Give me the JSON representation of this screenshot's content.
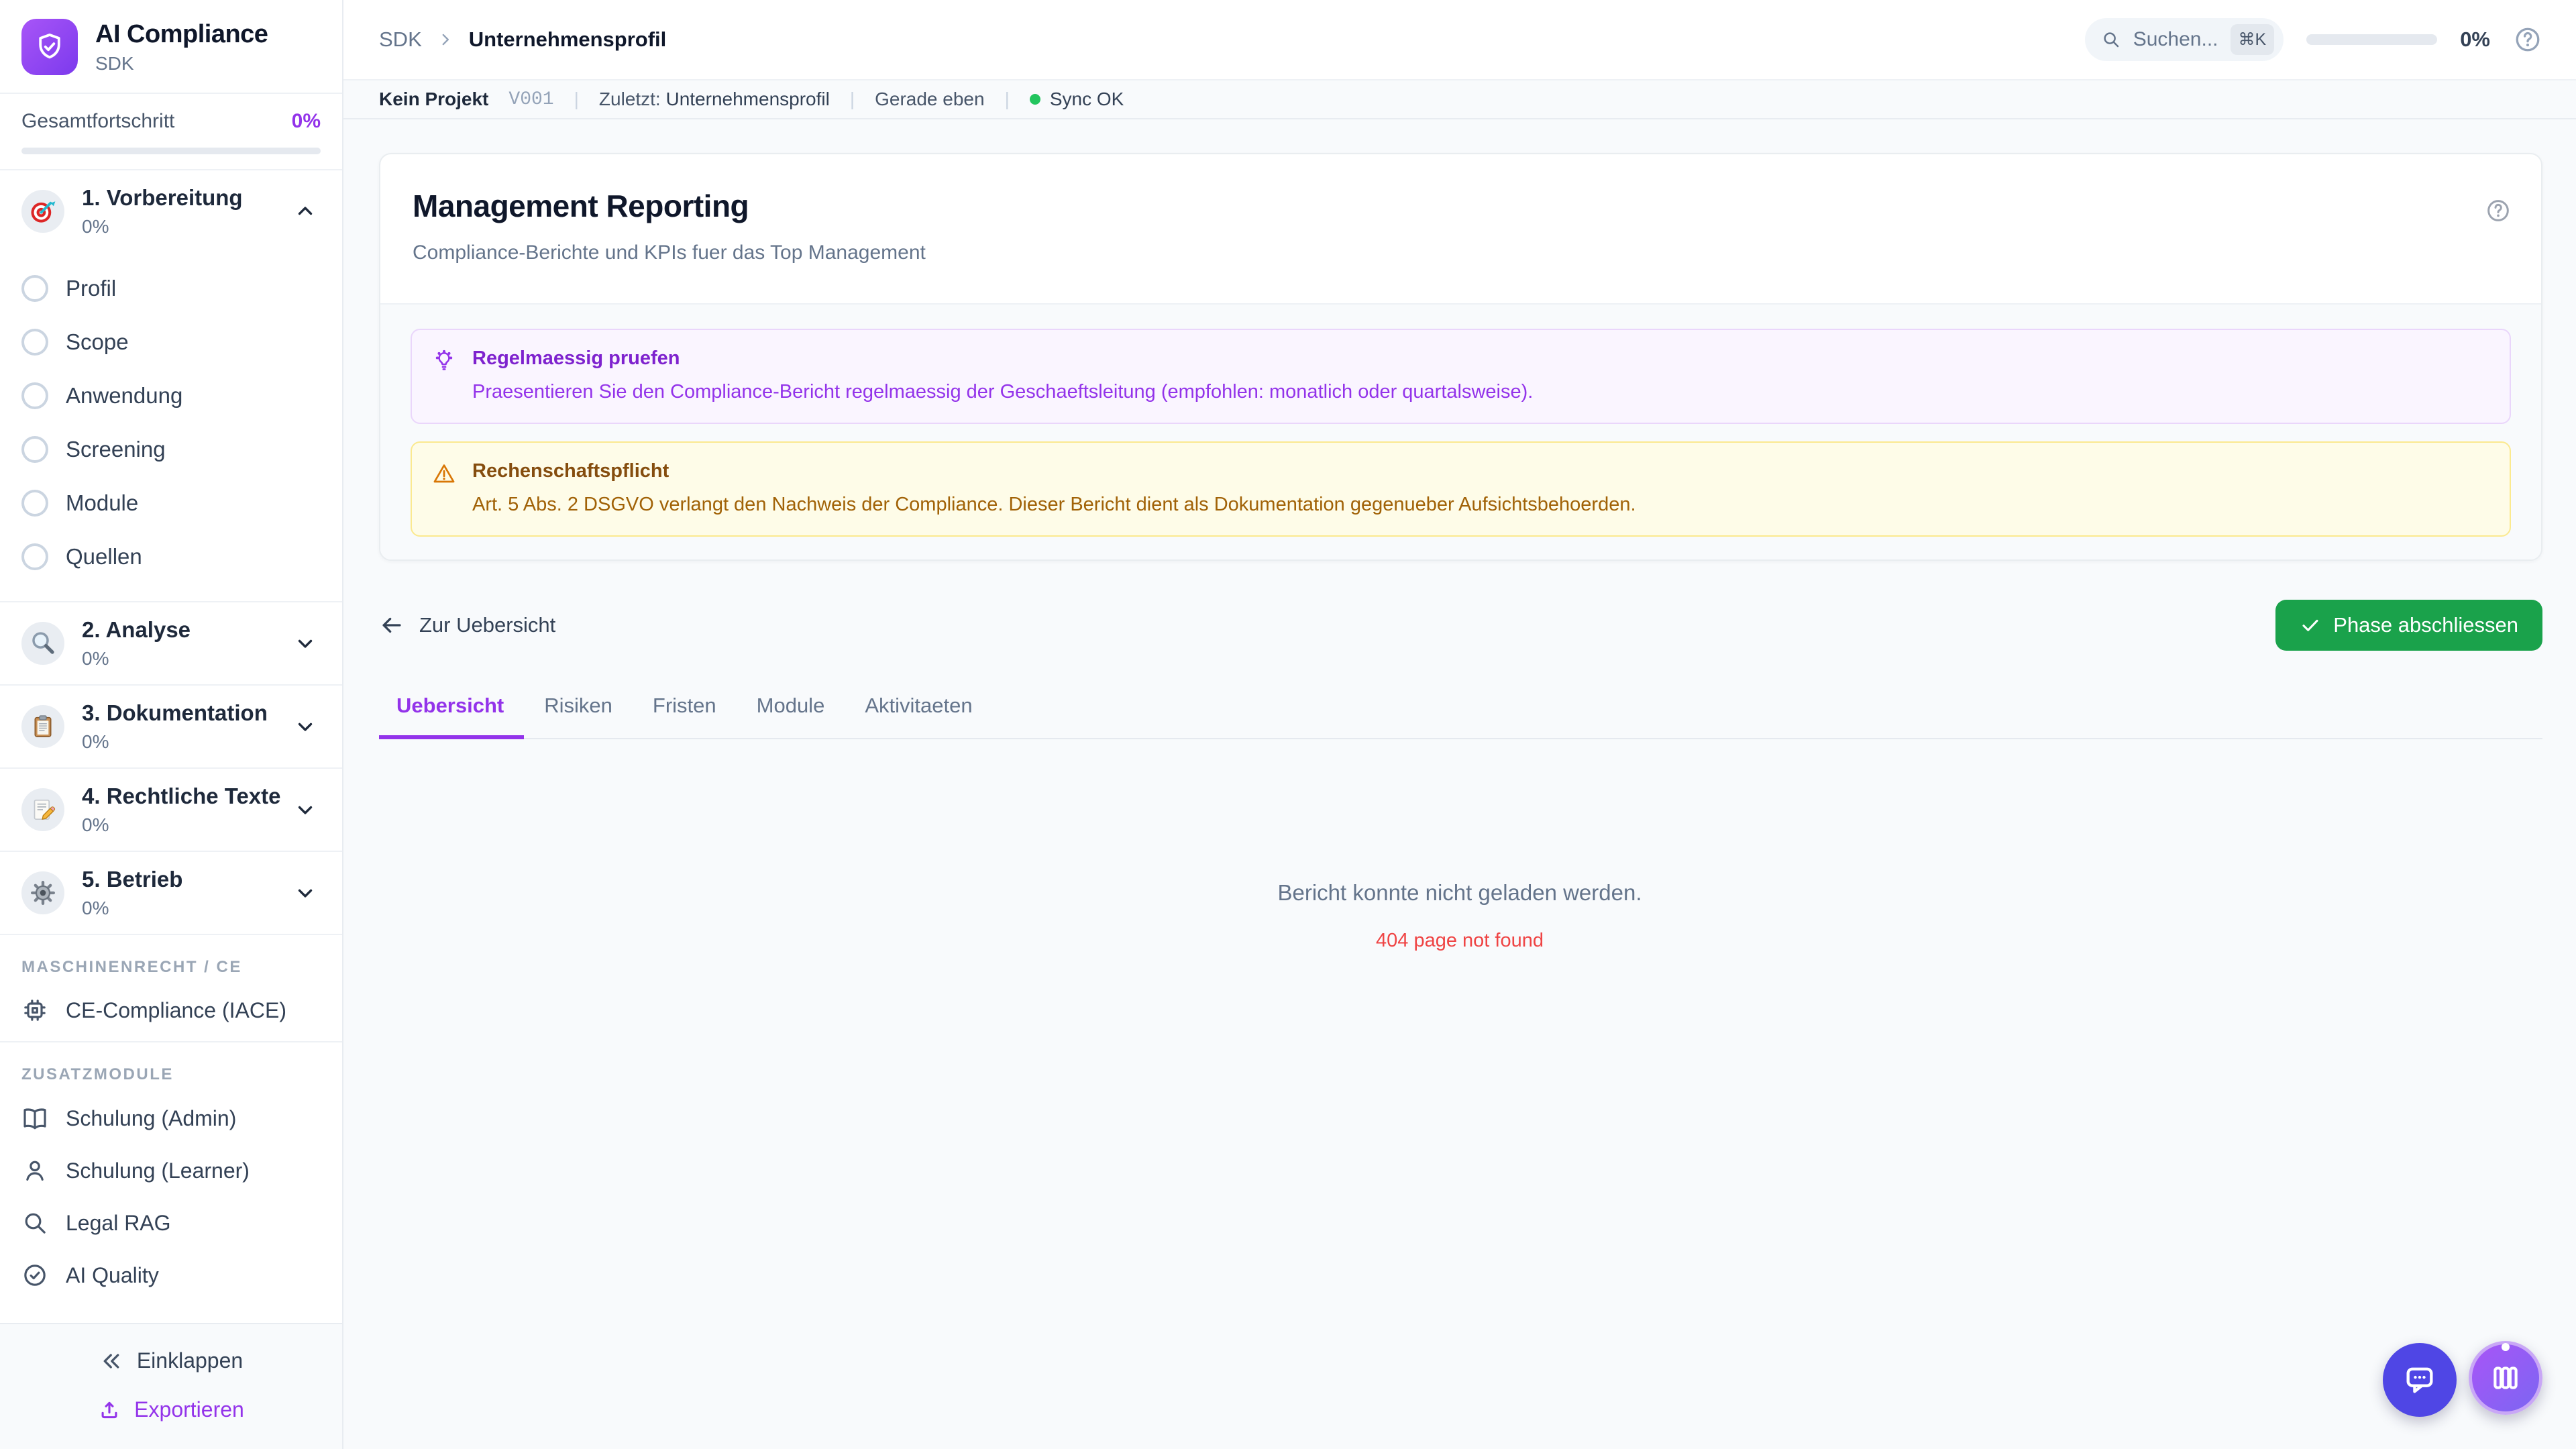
{
  "colors": {
    "accent": "#9333ea",
    "success": "#1aa24b",
    "error": "#ef4444",
    "sync": "#22c55e",
    "logo_gradient": [
      "#a855f7",
      "#7c3aed"
    ]
  },
  "sidebar": {
    "app_title": "AI Compliance",
    "app_subtitle": "SDK",
    "overall_progress_label": "Gesamtfortschritt",
    "overall_progress_value": "0%",
    "overall_progress_percent": 0,
    "phases": [
      {
        "label": "1. Vorbereitung",
        "progress": "0%",
        "icon": "target-icon",
        "expanded": true,
        "steps": [
          "Profil",
          "Scope",
          "Anwendung",
          "Screening",
          "Module",
          "Quellen"
        ]
      },
      {
        "label": "2. Analyse",
        "progress": "0%",
        "icon": "magnifier-icon",
        "expanded": false
      },
      {
        "label": "3. Dokumentation",
        "progress": "0%",
        "icon": "clipboard-icon",
        "expanded": false
      },
      {
        "label": "4. Rechtliche Texte",
        "progress": "0%",
        "icon": "memo-pencil-icon",
        "expanded": false
      },
      {
        "label": "5. Betrieb",
        "progress": "0%",
        "icon": "gear-icon",
        "expanded": false
      }
    ],
    "section_maschinenrecht": {
      "label": "MASCHINENRECHT / CE",
      "items": [
        {
          "label": "CE-Compliance (IACE)",
          "icon": "chip-icon"
        }
      ]
    },
    "section_zusatzmodule": {
      "label": "ZUSATZMODULE",
      "items": [
        {
          "label": "Schulung (Admin)",
          "icon": "book-open-icon"
        },
        {
          "label": "Schulung (Learner)",
          "icon": "person-icon"
        },
        {
          "label": "Legal RAG",
          "icon": "search-icon"
        },
        {
          "label": "AI Quality",
          "icon": "check-circle-icon"
        }
      ]
    },
    "footer": {
      "collapse_label": "Einklappen",
      "export_label": "Exportieren"
    }
  },
  "topbar": {
    "breadcrumb": {
      "root": "SDK",
      "current": "Unternehmensprofil"
    },
    "search_placeholder": "Suchen...",
    "search_shortcut": "⌘K",
    "progress_value": "0%",
    "progress_percent": 0
  },
  "statusbar": {
    "project": "Kein Projekt",
    "version": "V001",
    "sep": "|",
    "last_label": "Zuletzt:",
    "last_value": "Unternehmensprofil",
    "time": "Gerade eben",
    "sync": "Sync OK"
  },
  "page": {
    "title": "Management Reporting",
    "subtitle": "Compliance-Berichte und KPIs fuer das Top Management",
    "notices": [
      {
        "type": "tip",
        "icon": "lightbulb-icon",
        "title": "Regelmaessig pruefen",
        "text": "Praesentieren Sie den Compliance-Bericht regelmaessig der Geschaeftsleitung (empfohlen: monatlich oder quartalsweise)."
      },
      {
        "type": "warning",
        "icon": "warning-triangle-icon",
        "title": "Rechenschaftspflicht",
        "text": "Art. 5 Abs. 2 DSGVO verlangt den Nachweis der Compliance. Dieser Bericht dient als Dokumentation gegenueber Aufsichtsbehoerden."
      }
    ],
    "back_label": "Zur Uebersicht",
    "complete_label": "Phase abschliessen",
    "tabs": [
      "Uebersicht",
      "Risiken",
      "Fristen",
      "Module",
      "Aktivitaeten"
    ],
    "active_tab": "Uebersicht",
    "empty_title": "Bericht konnte nicht geladen werden.",
    "empty_error": "404 page not found"
  }
}
